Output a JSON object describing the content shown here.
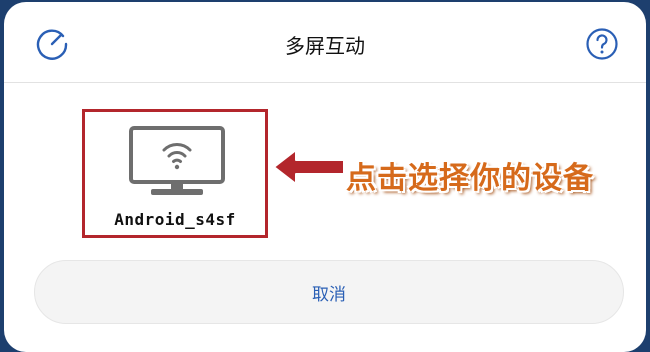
{
  "header": {
    "title": "多屏互动",
    "left_icon": "speedometer-icon",
    "right_icon": "help-icon"
  },
  "device": {
    "name": "Android_s4sf",
    "icon": "wifi-tv-icon"
  },
  "annotation": {
    "text": "点击选择你的设备",
    "color": "#d66a1b",
    "arrow_color": "#b3262c"
  },
  "actions": {
    "cancel_label": "取消"
  },
  "colors": {
    "accent": "#2a5fb5",
    "highlight_border": "#b3262c"
  }
}
